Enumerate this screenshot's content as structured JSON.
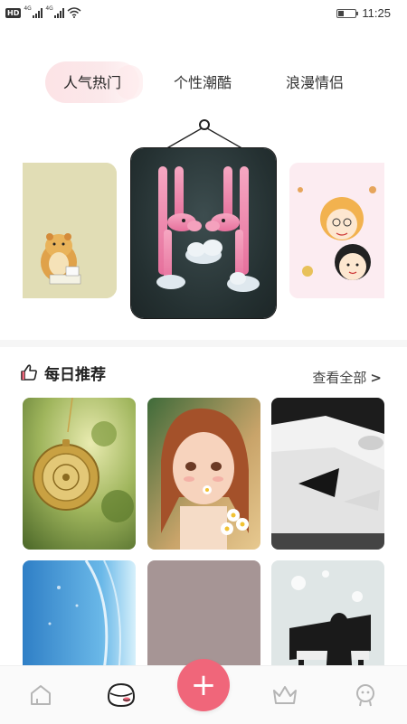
{
  "status_bar": {
    "hd_label": "HD",
    "network_1": "4G",
    "network_2": "4G",
    "time": "11:25"
  },
  "tabs": [
    {
      "label": "人气热门",
      "active": true
    },
    {
      "label": "个性潮酷",
      "active": false
    },
    {
      "label": "浪漫情侣",
      "active": false
    }
  ],
  "daily": {
    "title": "每日推荐",
    "see_all": "查看全部",
    "see_all_chevron": ">"
  },
  "bottom_nav": {
    "add_label": "+"
  },
  "colors": {
    "accent": "#f0667a",
    "tab_active_bg": "#fce3e6"
  },
  "icons": [
    "home-icon",
    "egg-face-icon",
    "add-icon",
    "crown-icon",
    "profile-icon",
    "thumbs-up-icon"
  ]
}
